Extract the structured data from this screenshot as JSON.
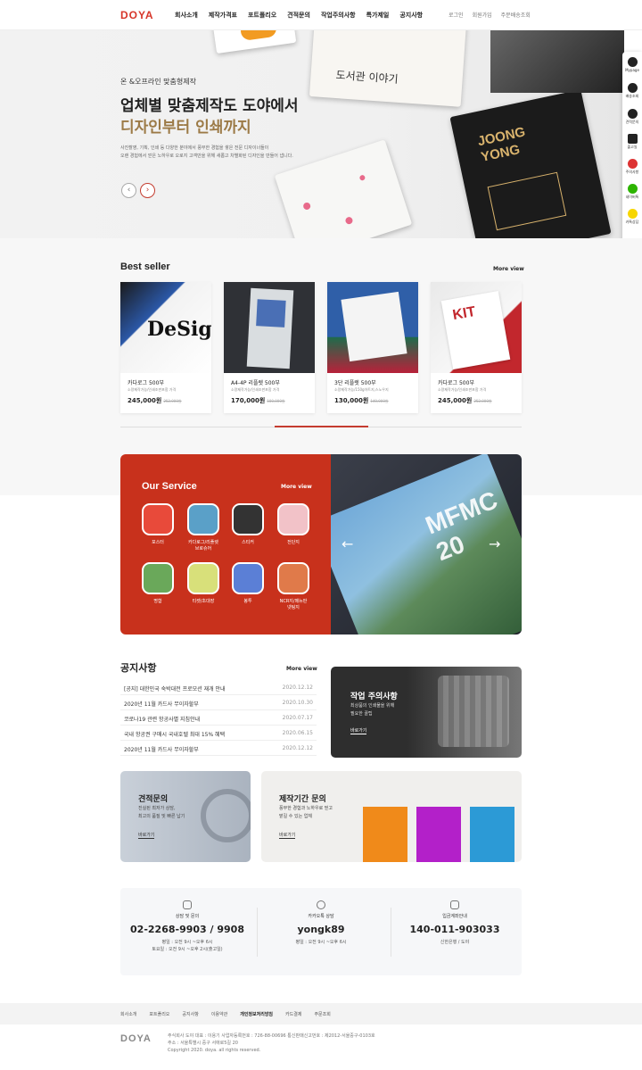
{
  "header": {
    "logo": "DOYA",
    "nav": [
      "회사소개",
      "제작가격표",
      "포트폴리오",
      "견적문의",
      "작업주의사항",
      "특가제일",
      "공지사항"
    ],
    "util": [
      "로그인",
      "회원가입",
      "주문배송조회"
    ]
  },
  "hero": {
    "subtitle": "온 &오프라인 맞춤형제작",
    "title1": "업체별 맞춤제작도 도야에서",
    "title2": "디자인부터 인쇄까지",
    "desc1": "사진촬영, 기획, 인쇄 등 다양한 분야에서 풍부한 경험을 쌓은 전문 디자이너들이",
    "desc2": "오랜 경험에서 얻은 노하우로 오로지 고객만을 위해 새롭고 차별화된 디자인을 만들어 냅니다.",
    "book1": "도서관 이야기",
    "book2a": "JOONG",
    "book2b": "YONG",
    "prev": "‹",
    "next": "›"
  },
  "side": [
    {
      "label": "Mypage",
      "icon": "user-icon"
    },
    {
      "label": "배송조회",
      "icon": "truck-icon"
    },
    {
      "label": "견적문의",
      "icon": "document-icon"
    },
    {
      "label": "출고일",
      "icon": "calendar-icon"
    },
    {
      "label": "주의사항",
      "icon": "warning-icon"
    },
    {
      "label": "네이버톡",
      "icon": "naver-talk-icon"
    },
    {
      "label": "카톡상담",
      "icon": "kakao-talk-icon"
    }
  ],
  "best": {
    "title": "Best seller",
    "more": "More view",
    "items": [
      {
        "name": "카다로그 500부",
        "desc": "소량제작가능/인쇄조판포함 가격",
        "price": "245,000",
        "unit": "원",
        "old": "252,000원"
      },
      {
        "name": "A4-4P 리플렛 500부",
        "desc": "소량제작가능/인쇄조판포함 가격",
        "price": "170,000",
        "unit": "원",
        "old": "180,000원"
      },
      {
        "name": "3단 리플렛 500부",
        "desc": "소량제작가능/150g아트지,스노우지",
        "price": "130,000",
        "unit": "원",
        "old": "140,000원"
      },
      {
        "name": "카다로그 500부",
        "desc": "소량제작가능/인쇄조판포함 가격",
        "price": "245,000",
        "unit": "원",
        "old": "252,000원"
      }
    ]
  },
  "service": {
    "title": "Our Service",
    "more": "More view",
    "items": [
      "포스터",
      "카다로그/리플렛\n브로슈어",
      "스티커",
      "전단지",
      "명함",
      "티켓/초대장",
      "봉투",
      "NCR지/메뉴판\n넷팅지"
    ],
    "promo": "MFMC 20"
  },
  "notice": {
    "title": "공지사항",
    "more": "More view",
    "rows": [
      {
        "text": "[공지] 대한민국 숙박대전 프로모션 재개 안내",
        "date": "2020.12.12"
      },
      {
        "text": "2020년 11월 카드사 무이자할부",
        "date": "2020.10.30"
      },
      {
        "text": "코로나19 관련 항공사별 지침안내",
        "date": "2020.07.17"
      },
      {
        "text": "국내 항공권 구매시 국내호텔 최대 15% 혜택",
        "date": "2020.06.15"
      },
      {
        "text": "2020년 11월 카드사 무이자할부",
        "date": "2020.12.12"
      }
    ]
  },
  "work": {
    "title": "작업 주의사항",
    "sub1": "최상품의 인쇄물을 위해",
    "sub2": "필요한 꿀팁",
    "link": "바로가기"
  },
  "quote": {
    "title": "견적문의",
    "sub1": "진실된 최저가 상담,",
    "sub2": "최고의 품질 및 빠른 납기",
    "link": "바로가기"
  },
  "period": {
    "title": "제작기간 문의",
    "sub1": "풍부한 경험과 노하우로 믿고",
    "sub2": "맡길 수 있는 업체",
    "link": "바로가기"
  },
  "contact": [
    {
      "label": "상담 및 문의",
      "big": "02-2268-9903 / 9908",
      "l1": "평일 : 오전 9시 ~오후 6시",
      "l2": "토요일 : 오전 9시 ~오후 2시(출고일)"
    },
    {
      "label": "카카오톡 상담",
      "big": "yongk89",
      "l1": "평일 : 오전 9시 ~오후 6시",
      "l2": ""
    },
    {
      "label": "입금계좌안내",
      "big": "140-011-903033",
      "l1": "신한은행 / 도야",
      "l2": ""
    }
  ],
  "footer": {
    "links": [
      "회사소개",
      "포트폴리오",
      "공지사항",
      "이용약관",
      "개인정보처리방침",
      "카드결제",
      "주문조회"
    ],
    "logo": "DOYA",
    "info1": "주식회사 도야   대표 : 이용기   사업자등록번호 : 726-88-00696   통신판매신고번호 : 제2012-서울중구-0103호",
    "info2": "주소 : 서울특별시 중구 서애로5길 20",
    "copy": "Copyright 2020. doya. all rights reserved."
  },
  "colors": {
    "brand": "#c8311c",
    "gold": "#9c7a46"
  }
}
